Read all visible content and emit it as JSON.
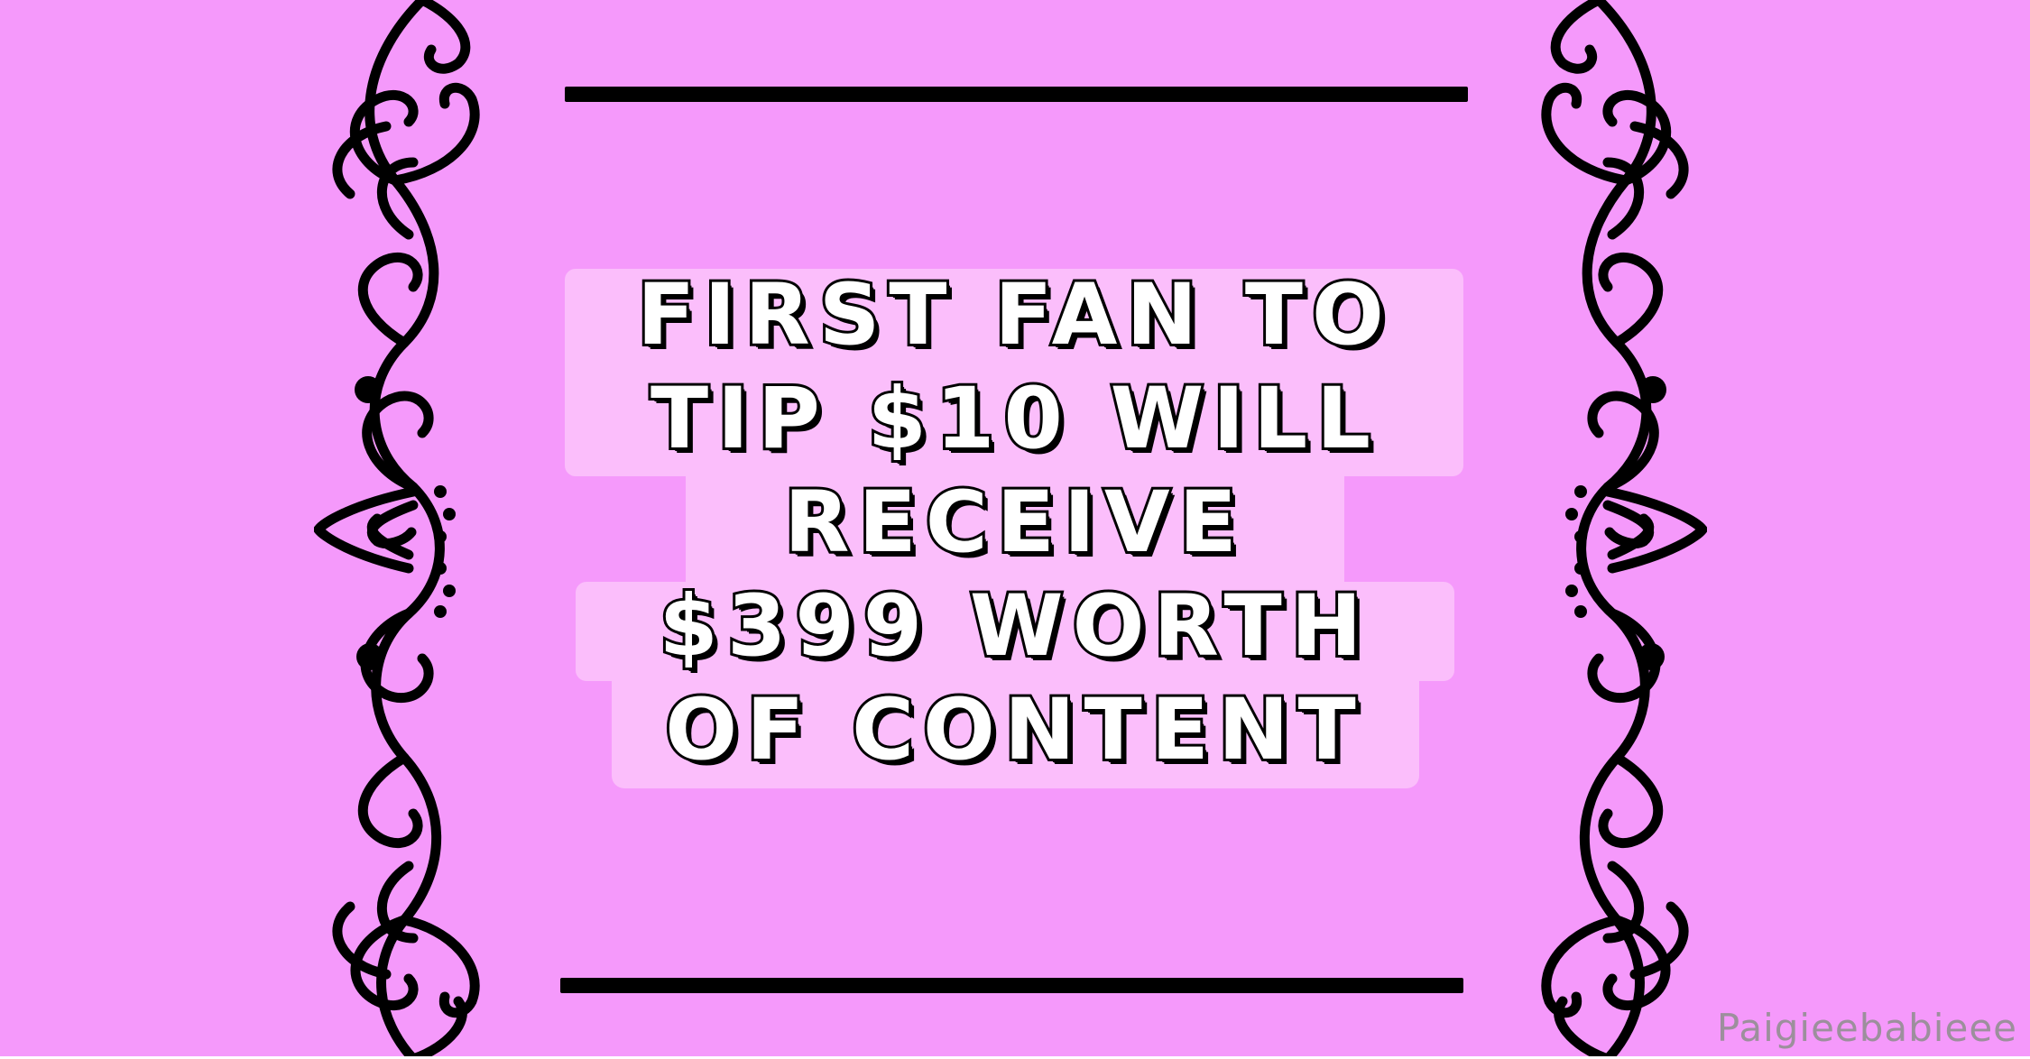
{
  "colors": {
    "background": "#f599fb",
    "text_plate": "#fbbefb",
    "ornament": "#000000",
    "text_fill": "#ffffff",
    "text_outline": "#000000",
    "watermark": "#9c8f9c"
  },
  "message": {
    "lines": [
      "First fan to",
      "tip $10 will",
      "receive",
      "$399 worth",
      "of content"
    ]
  },
  "watermark": "Paigieebabieee",
  "ornaments": {
    "left_icon": "flourish-scroll-icon",
    "right_icon": "flourish-scroll-icon",
    "rules": "horizontal-rule"
  }
}
